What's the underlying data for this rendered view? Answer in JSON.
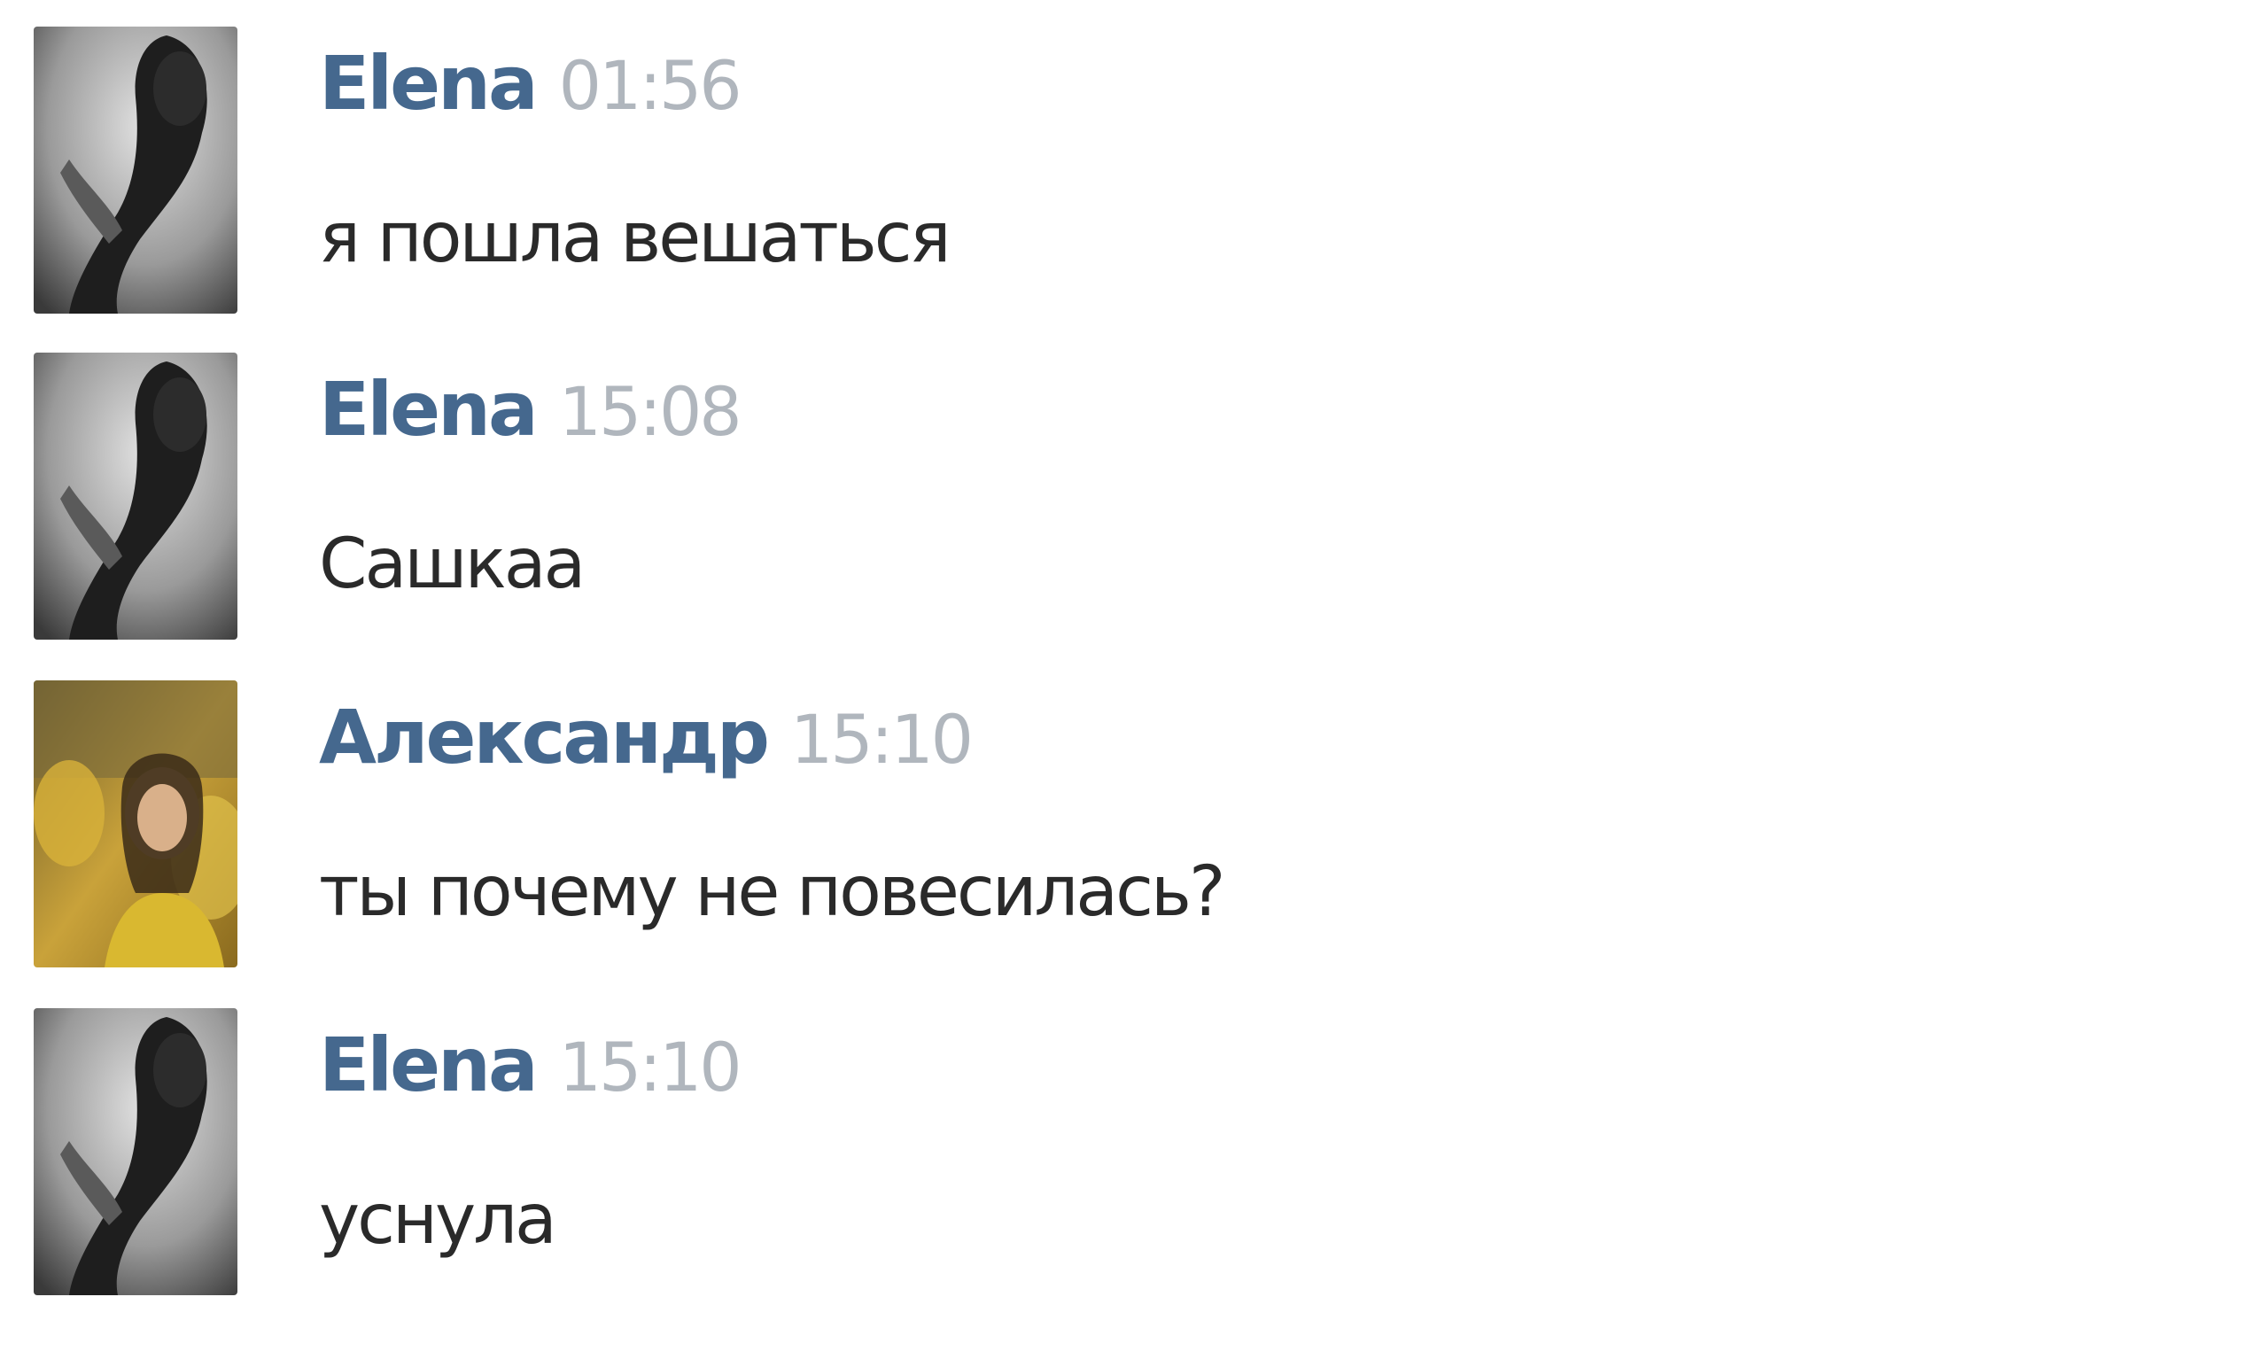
{
  "messages": [
    {
      "author": "Elena",
      "time": "01:56",
      "text": "я пошла вешаться",
      "avatar_icon": "elena-avatar"
    },
    {
      "author": "Elena",
      "time": "15:08",
      "text": "Сашкаа",
      "avatar_icon": "elena-avatar"
    },
    {
      "author": "Александр",
      "time": "15:10",
      "text": "ты почему не повесилась?",
      "avatar_icon": "aleksandr-avatar"
    },
    {
      "author": "Elena",
      "time": "15:10",
      "text": "уснула",
      "avatar_icon": "elena-avatar"
    }
  ],
  "colors": {
    "author": "#45688e",
    "time": "#b0b6bd",
    "text": "#2a2a2a",
    "background": "#ffffff"
  }
}
